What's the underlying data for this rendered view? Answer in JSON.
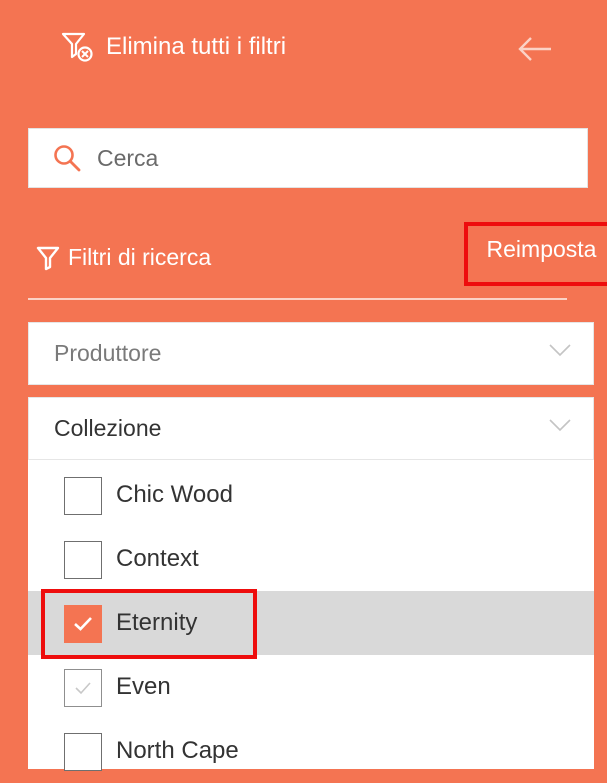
{
  "header": {
    "clear_filters_label": "Elimina tutti i filtri",
    "back_icon": "arrow-left-icon"
  },
  "search": {
    "placeholder": "Cerca",
    "value": ""
  },
  "filters": {
    "title": "Filtri di ricerca",
    "reset_label": "Reimposta"
  },
  "dropdowns": {
    "producer_label": "Produttore",
    "collection_label": "Collezione"
  },
  "collection_items": [
    {
      "label": "Chic Wood",
      "checked": false
    },
    {
      "label": "Context",
      "checked": false
    },
    {
      "label": "Eternity",
      "checked": true
    },
    {
      "label": "Even",
      "checked": false
    },
    {
      "label": "North Cape",
      "checked": false
    }
  ],
  "colors": {
    "accent": "#f47452",
    "highlight_border": "#ee0d0d",
    "selected_row": "#d9d9d9"
  }
}
